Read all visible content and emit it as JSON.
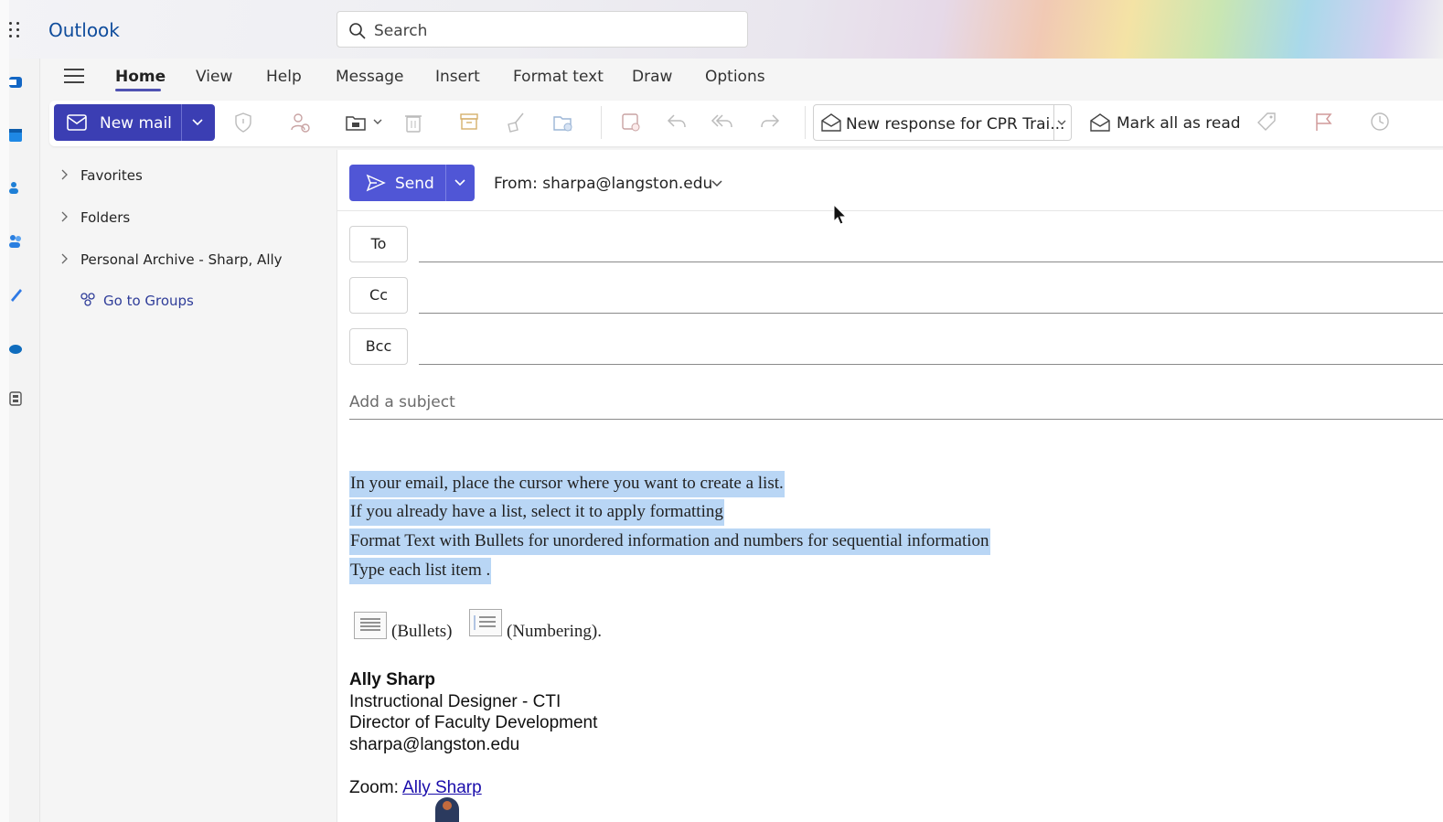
{
  "app": {
    "title": "Outlook"
  },
  "search": {
    "placeholder": "Search"
  },
  "tabs": [
    "Home",
    "View",
    "Help",
    "Message",
    "Insert",
    "Format text",
    "Draw",
    "Options"
  ],
  "toolbar": {
    "new_mail_label": "New mail",
    "new_response_label": "New response for CPR Trai...",
    "mark_all_read_label": "Mark all as read"
  },
  "folders": {
    "items": [
      "Favorites",
      "Folders",
      "Personal Archive - Sharp, Ally"
    ],
    "groups_link": "Go to Groups"
  },
  "compose": {
    "send_label": "Send",
    "from_label": "From: sharpa@langston.edu",
    "to_label": "To",
    "cc_label": "Cc",
    "bcc_label": "Bcc",
    "subject_placeholder": "Add a subject",
    "body_lines": [
      "In your email, place the cursor where you want to create a list.",
      "If you already have a list, select it to apply formatting",
      "Format Text with Bullets for unordered information and numbers for sequential information",
      "Type each list item ."
    ],
    "bullets_text": "(Bullets)",
    "numbering_text": "(Numbering).",
    "signature": {
      "name": "Ally Sharp",
      "title1": "Instructional Designer - CTI",
      "title2": "Director of Faculty Development",
      "email": "sharpa@langston.edu",
      "zoom_label": "Zoom:",
      "zoom_link": "Ally Sharp"
    }
  },
  "colors": {
    "accent": "#3b3eb3",
    "send": "#5056d6",
    "selection": "#b9d6f5",
    "brand_title": "#0f4c9c"
  }
}
